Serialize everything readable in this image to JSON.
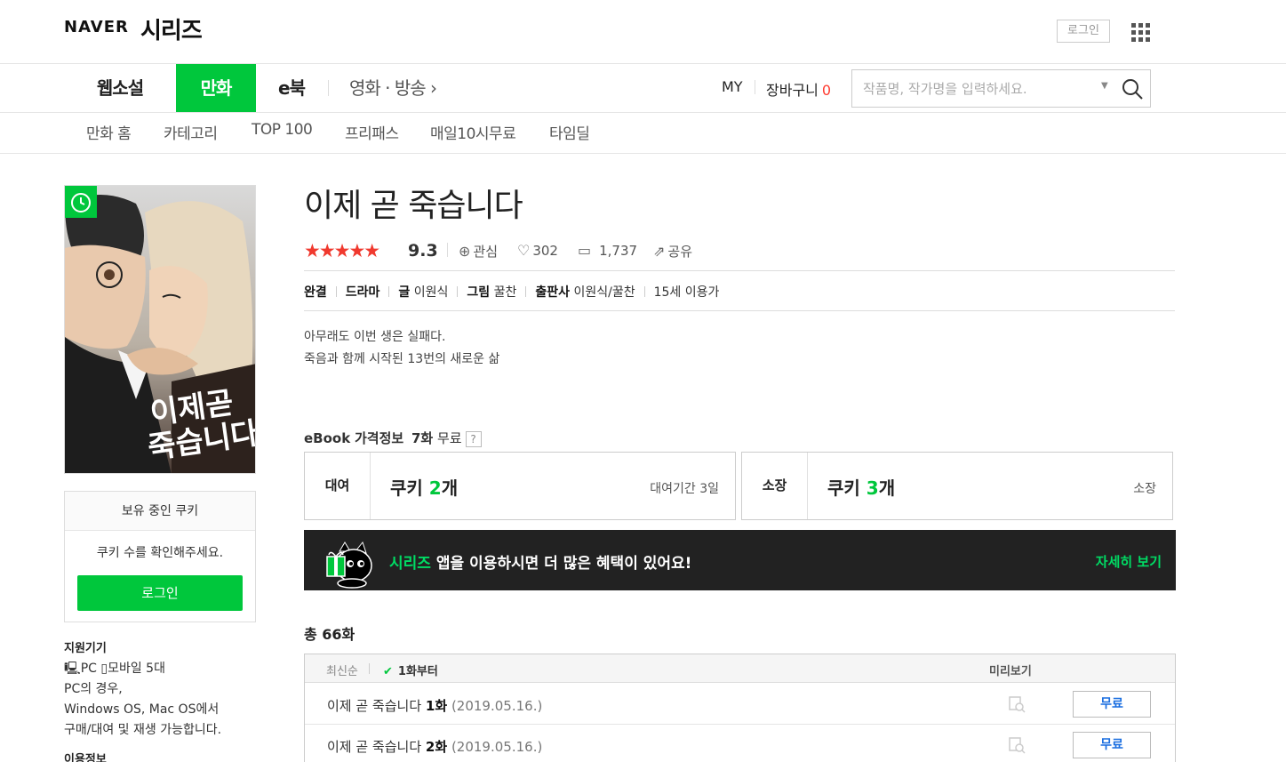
{
  "header": {
    "logo_naver": "NAVER",
    "logo_series": "시리즈",
    "login_label": "로그인"
  },
  "main_nav": {
    "webnovel": "웹소설",
    "manga": "만화",
    "ebook": "e북",
    "movie": "영화 · 방송 ›",
    "my": "MY",
    "cart": "장바구니",
    "cart_count": "0",
    "search_placeholder": "작품명, 작가명을 입력하세요."
  },
  "sub_nav": [
    "만화 홈",
    "카테고리",
    "TOP 100",
    "프리패스",
    "매일10시무료",
    "타임딜"
  ],
  "cover": {
    "badge_icon": "timer-icon",
    "art_text": "이제 곧 죽습니다"
  },
  "cookie": {
    "head": "보유 중인 쿠키",
    "message": "쿠키 수를 확인해주세요.",
    "login": "로그인"
  },
  "device": {
    "title": "지원기기",
    "pc": "PC",
    "mobile": "모바일 5대",
    "line1": "PC의 경우,",
    "line2": "Windows OS, Mac OS에서",
    "line3": "구매/대여 및 재생 가능합니다."
  },
  "usage_title": "이용정보",
  "work": {
    "title": "이제 곧 죽습니다",
    "stars": "★★★★★",
    "rating": "9.3",
    "interest": "관심",
    "likes": "302",
    "comments": "1,737",
    "share": "공유",
    "status": "완결",
    "genre": "드라마",
    "writer_label": "글",
    "writer": "이원식",
    "art_label": "그림",
    "artist": "꿀찬",
    "publisher_label": "출판사",
    "publisher": "이원식/꿀찬",
    "age": "15세 이용가",
    "desc1": "아무래도 이번 생은 실패다.",
    "desc2": "죽음과 함께 시작된 13번의 새로운 삶"
  },
  "ebook": {
    "label": "eBook",
    "price_info": "가격정보",
    "free_count": "7화",
    "free": "무료",
    "help": "?",
    "rent_label": "대여",
    "rent_cookie": "쿠키",
    "rent_num": "2",
    "rent_unit": "개",
    "rent_period": "대여기간 3일",
    "own_label": "소장",
    "own_cookie": "쿠키",
    "own_num": "3",
    "own_unit": "개",
    "own_sub": "소장"
  },
  "banner": {
    "brand": "시리즈",
    "text": " 앱을 이용하시면 더 많은 혜택이 있어요!",
    "more": "자세히 보기"
  },
  "episodes": {
    "total": "총 66화",
    "sort_newest": "최신순",
    "sort_first": "1화부터",
    "preview": "미리보기",
    "rows": [
      {
        "title": "이제 곧 죽습니다",
        "ep": "1화",
        "date": "(2019.05.16.)",
        "btn": "무료"
      },
      {
        "title": "이제 곧 죽습니다",
        "ep": "2화",
        "date": "(2019.05.16.)",
        "btn": "무료"
      }
    ]
  },
  "colors": {
    "accent_green": "#00c73c",
    "star_red": "#f0392e",
    "free_blue": "#1a6ee0",
    "banner_bg": "#222222"
  }
}
